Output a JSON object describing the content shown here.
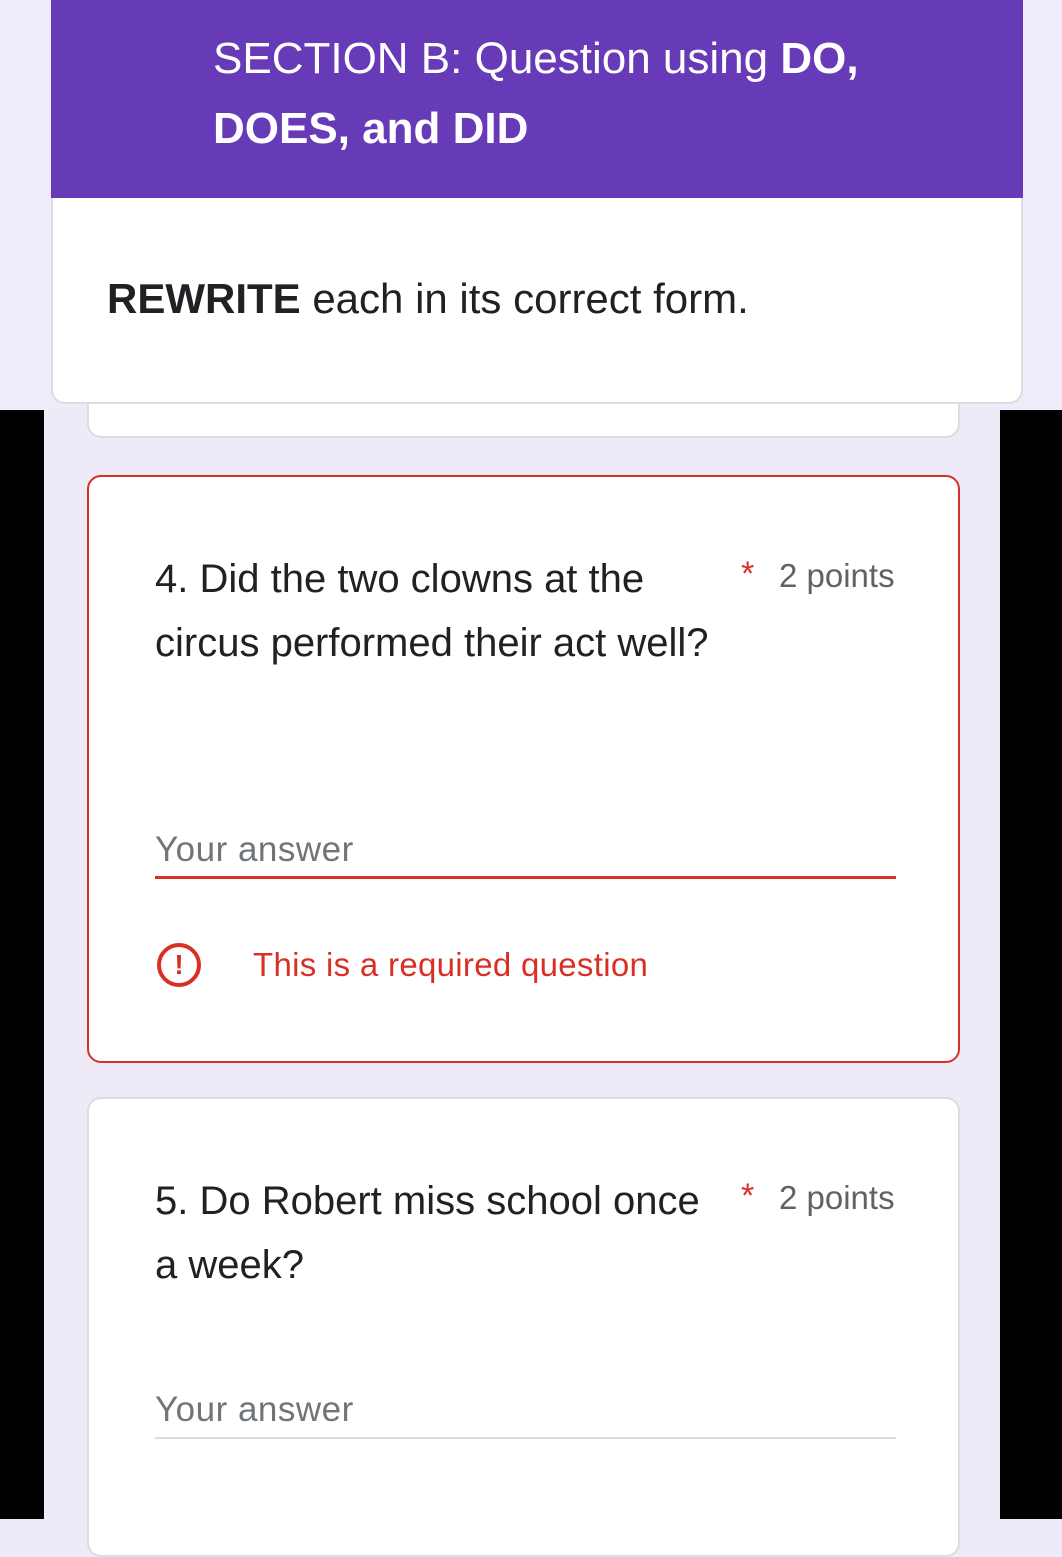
{
  "section": {
    "title_prefix": "SECTION B: Question using ",
    "title_bold": "DO, DOES, and DID",
    "desc_bold": "REWRITE",
    "desc_rest": " each in its correct form."
  },
  "questions": [
    {
      "text": "4. Did the two clowns at the circus performed their act well?",
      "required_mark": "*",
      "points": "2 points",
      "answer_placeholder": "Your answer",
      "error": "This is a required question",
      "error_icon": "!"
    },
    {
      "text": "5. Do Robert miss school once a week?",
      "required_mark": "*",
      "points": "2 points",
      "answer_placeholder": "Your answer"
    }
  ],
  "colors": {
    "header": "#673ab7",
    "error": "#d93025",
    "background": "#efeaf7"
  }
}
